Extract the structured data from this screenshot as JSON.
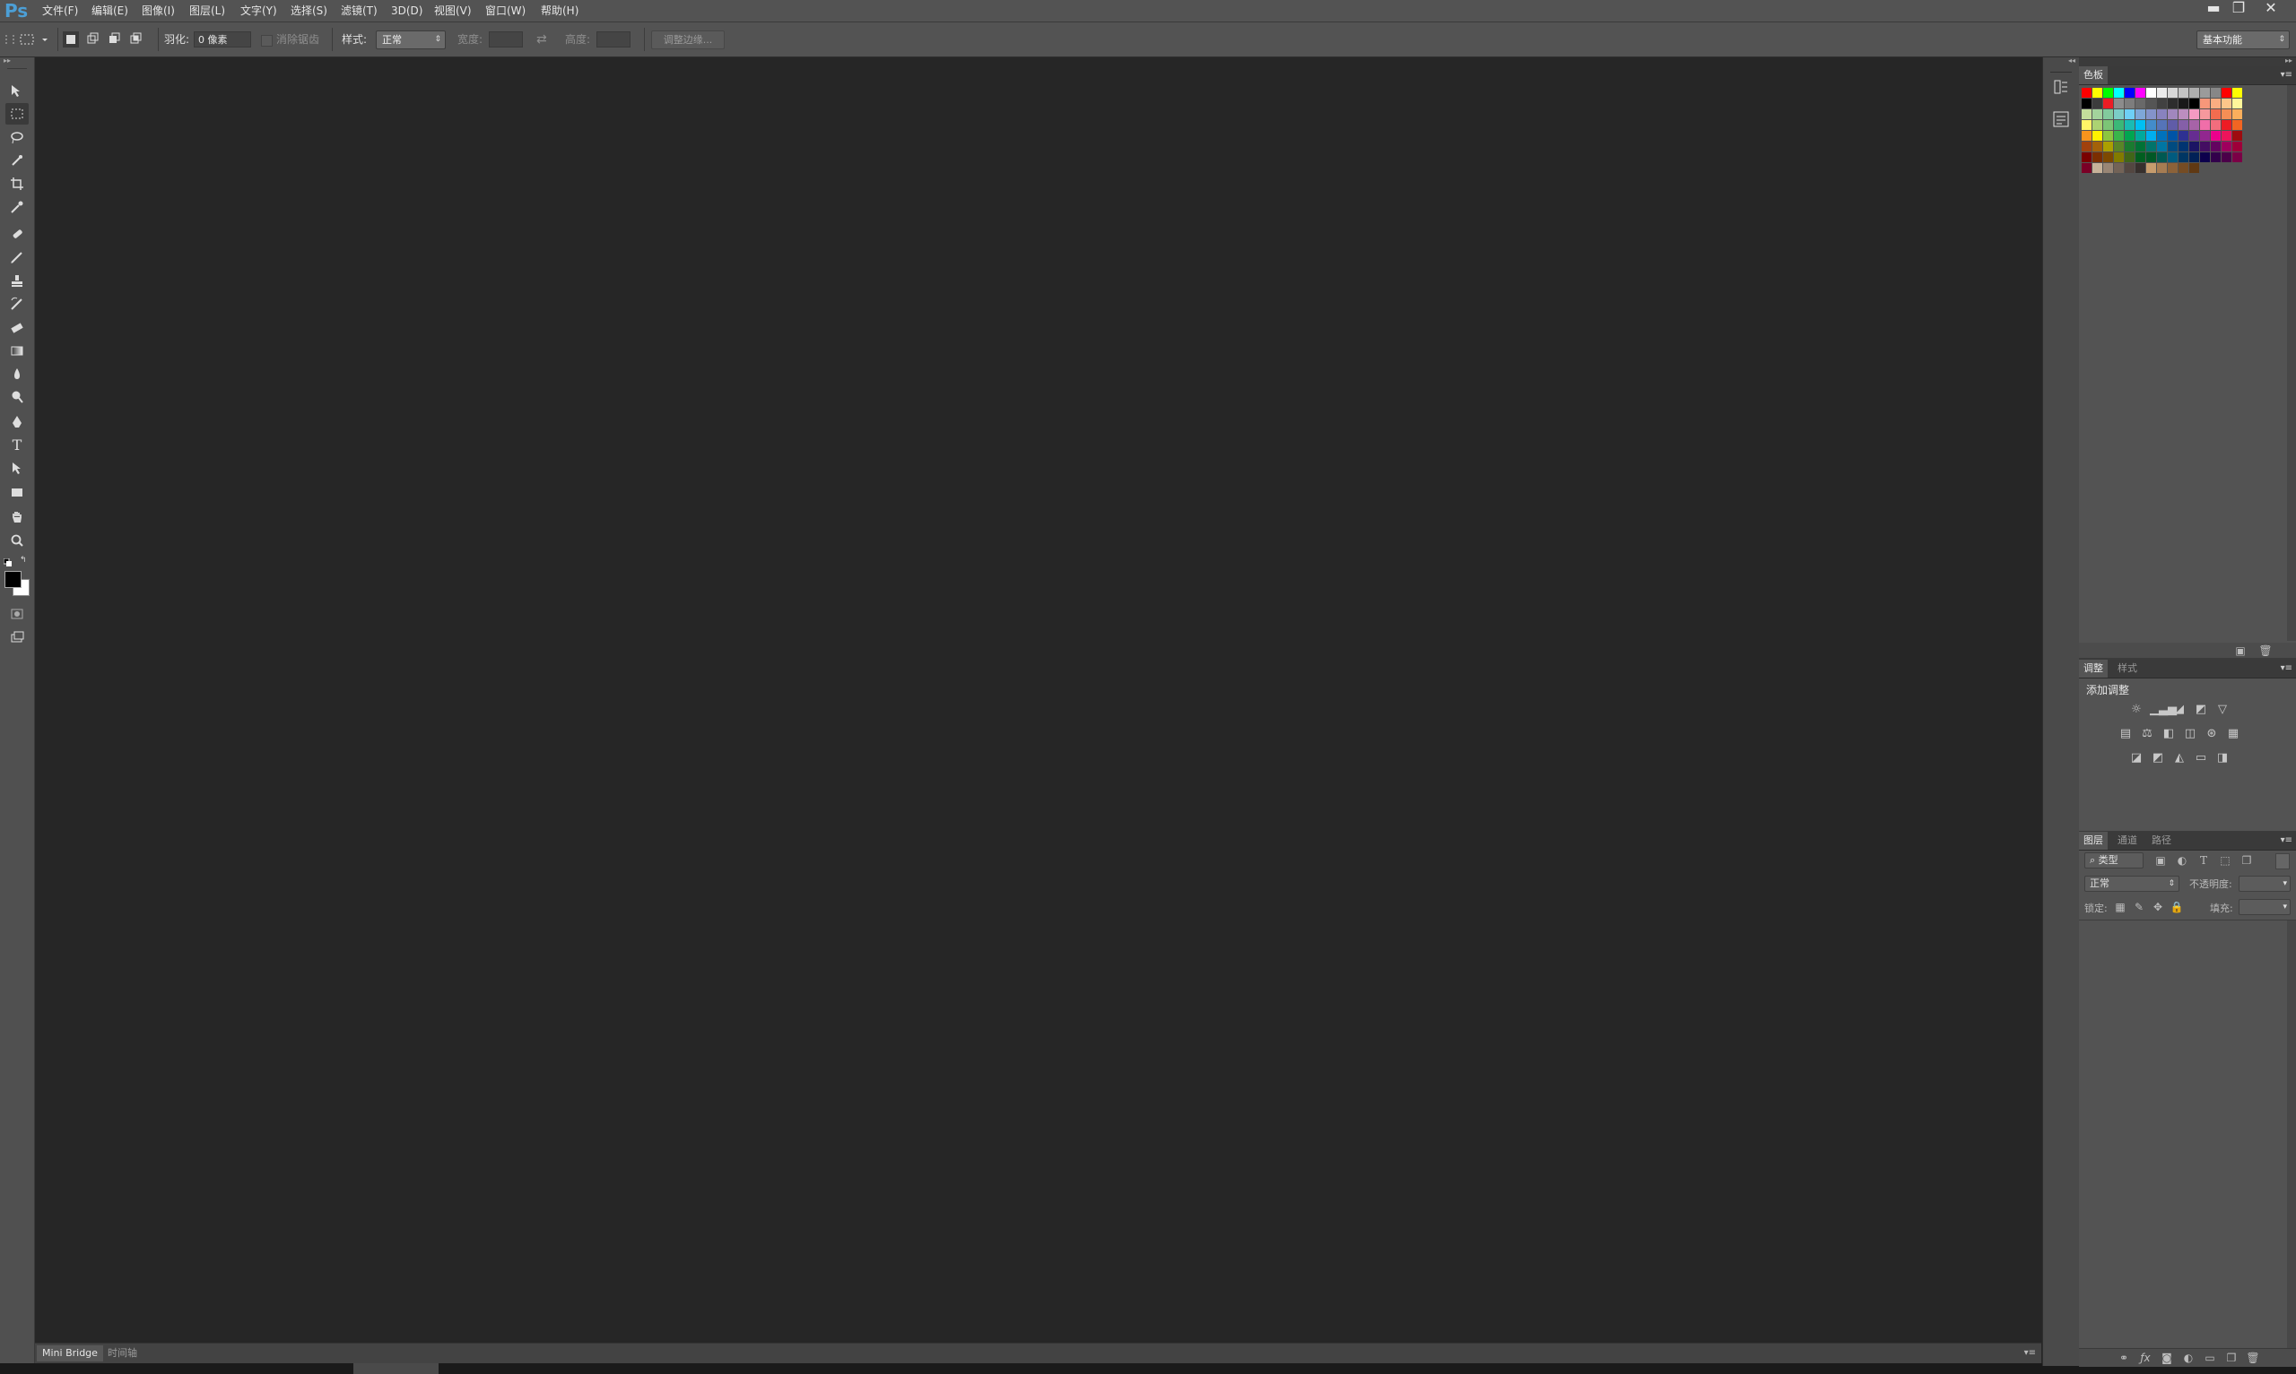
{
  "app": {
    "logo": "Ps"
  },
  "menu": [
    "文件(F)",
    "编辑(E)",
    "图像(I)",
    "图层(L)",
    "文字(Y)",
    "选择(S)",
    "滤镜(T)",
    "3D(D)",
    "视图(V)",
    "窗口(W)",
    "帮助(H)"
  ],
  "window_controls": {
    "minimize": "▬",
    "restore": "❐",
    "close": "✕"
  },
  "options": {
    "feather_label": "羽化:",
    "feather_value": "0 像素",
    "antialias_label": "消除锯齿",
    "style_label": "样式:",
    "style_value": "正常",
    "width_label": "宽度:",
    "height_label": "高度:",
    "refine_edge": "调整边缘...",
    "workspace": "基本功能"
  },
  "tools": [
    "move-tool",
    "marquee-tool",
    "lasso-tool",
    "quick-select-tool",
    "crop-tool",
    "eyedropper-tool",
    "healing-brush-tool",
    "brush-tool",
    "clone-stamp-tool",
    "history-brush-tool",
    "eraser-tool",
    "gradient-tool",
    "blur-tool",
    "dodge-tool",
    "pen-tool",
    "type-tool",
    "path-select-tool",
    "rectangle-tool",
    "hand-tool",
    "zoom-tool"
  ],
  "colors": {
    "foreground": "#000000",
    "background": "#ffffff",
    "canvas": "#262626",
    "panel": "#535353",
    "accent": "#4c9fd6"
  },
  "status": {
    "tab1": "Mini Bridge",
    "tab2": "时间轴"
  },
  "swatches_panel": {
    "tab": "色板",
    "rows": [
      [
        "#ff0000",
        "#ffff00",
        "#00ff00",
        "#00ffff",
        "#0000ff",
        "#ff00ff",
        "#ffffff",
        "#ebebeb",
        "#d7d7d7",
        "#c3c3c3",
        "#afafaf",
        "#9b9b9b",
        "#878787",
        "#ff0000",
        "#ffff00"
      ],
      [
        "#000000",
        "#3c3c3c",
        "#ed1c24",
        "#8c8c8c",
        "#7d7d7d",
        "#696969",
        "#555555",
        "#414141",
        "#2d2d2d",
        "#191919",
        "#000000",
        "#f7977a",
        "#f9ad81",
        "#fdc68a",
        "#fff79a"
      ],
      [
        "#c4df9b",
        "#a3d39c",
        "#82ca9d",
        "#7bcdc8",
        "#6ecff6",
        "#7ea7d8",
        "#8493ca",
        "#8882be",
        "#a187be",
        "#bc8dbf",
        "#f49ac2",
        "#f6989d",
        "#f26c4f",
        "#f68e55",
        "#fbaf5c"
      ],
      [
        "#fff467",
        "#acd372",
        "#7cc576",
        "#3bb878",
        "#1abbb4",
        "#00bff3",
        "#438ccb",
        "#5574b9",
        "#605ca8",
        "#855fa8",
        "#a763a8",
        "#f06ea9",
        "#f26d7d",
        "#ed1c24",
        "#f26522"
      ],
      [
        "#f7941d",
        "#fff200",
        "#8dc63f",
        "#39b54a",
        "#00a651",
        "#00a99d",
        "#00aeef",
        "#0072bc",
        "#0054a6",
        "#2e3192",
        "#662d91",
        "#92278f",
        "#ec008c",
        "#ed145b",
        "#9e0b0f"
      ],
      [
        "#a0410d",
        "#a36209",
        "#aba000",
        "#598527",
        "#1a7b30",
        "#007236",
        "#00746b",
        "#0076a3",
        "#004b80",
        "#003471",
        "#1b1464",
        "#440e62",
        "#630460",
        "#9e005d",
        "#9e0039"
      ],
      [
        "#790000",
        "#7b2e00",
        "#7d4900",
        "#827b00",
        "#406618",
        "#005e20",
        "#005826",
        "#005952",
        "#005b7f",
        "#003663",
        "#002157",
        "#0d004c",
        "#32004b",
        "#4b0049",
        "#7b0046"
      ],
      [
        "#7a0026",
        "#c7b299",
        "#998675",
        "#736357",
        "#534741",
        "#37302d",
        "#c69c6d",
        "#a67c52",
        "#8c6239",
        "#754c24",
        "#603913",
        "#",
        "#",
        "#",
        ""
      ]
    ]
  },
  "adjust_panel": {
    "tab1": "调整",
    "tab2": "样式",
    "title": "添加调整",
    "icon_rows": [
      [
        "brightness-icon",
        "levels-icon",
        "curves-icon",
        "exposure-icon",
        "vibrance-icon"
      ],
      [
        "hue-sat-icon",
        "color-balance-icon",
        "bw-icon",
        "photo-filter-icon",
        "channel-mixer-icon",
        "color-lookup-icon"
      ],
      [
        "invert-icon",
        "posterize-icon",
        "threshold-icon",
        "gradient-map-icon",
        "selective-color-icon"
      ]
    ]
  },
  "layers_panel": {
    "tab1": "图层",
    "tab2": "通道",
    "tab3": "路径",
    "filter": "类型",
    "blend_mode": "正常",
    "opacity_label": "不透明度:",
    "lock_label": "锁定:",
    "fill_label": "填充:"
  }
}
